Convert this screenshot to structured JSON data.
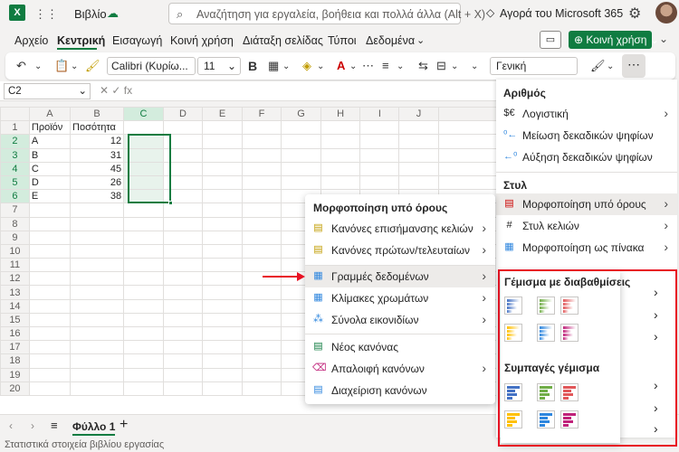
{
  "app": {
    "logo": "X",
    "book_title": "Βιβλίο",
    "search_placeholder": "Αναζήτηση για εργαλεία, βοήθεια και πολλά άλλα (Alt + X)",
    "buy_label": "Αγορά του Microsoft 365"
  },
  "tabs": [
    "Αρχείο",
    "Κεντρική",
    "Εισαγωγή",
    "Κοινή χρήση",
    "Διάταξη σελίδας",
    "Τύποι",
    "Δεδομένα"
  ],
  "share_label": "Κοινή χρήση",
  "toolbar": {
    "font": "Calibri (Κυρίω...",
    "size": "11",
    "bold": "B",
    "number_format": "Γενική"
  },
  "namebox": "C2",
  "formula_icons": "✕   ✓   fx",
  "columns": [
    "A",
    "B",
    "C",
    "D",
    "E",
    "F",
    "G",
    "H",
    "I",
    "J"
  ],
  "rows": [
    {
      "n": "1",
      "a": "Προϊόν",
      "b": "Ποσότητα"
    },
    {
      "n": "2",
      "a": "A",
      "b": "12"
    },
    {
      "n": "3",
      "a": "B",
      "b": "31"
    },
    {
      "n": "4",
      "a": "C",
      "b": "45"
    },
    {
      "n": "5",
      "a": "D",
      "b": "26"
    },
    {
      "n": "6",
      "a": "E",
      "b": "38"
    },
    {
      "n": "7",
      "a": "",
      "b": ""
    },
    {
      "n": "8",
      "a": "",
      "b": ""
    },
    {
      "n": "9",
      "a": "",
      "b": ""
    },
    {
      "n": "10",
      "a": "",
      "b": ""
    },
    {
      "n": "11",
      "a": "",
      "b": ""
    },
    {
      "n": "12",
      "a": "",
      "b": ""
    },
    {
      "n": "13",
      "a": "",
      "b": ""
    },
    {
      "n": "14",
      "a": "",
      "b": ""
    },
    {
      "n": "15",
      "a": "",
      "b": ""
    },
    {
      "n": "16",
      "a": "",
      "b": ""
    },
    {
      "n": "17",
      "a": "",
      "b": ""
    },
    {
      "n": "18",
      "a": "",
      "b": ""
    },
    {
      "n": "19",
      "a": "",
      "b": ""
    },
    {
      "n": "20",
      "a": "",
      "b": ""
    }
  ],
  "sheet_tab": "Φύλλο 1",
  "status": "Στατιστικά στοιχεία βιβλίου εργασίας",
  "cf_menu": {
    "title": "Μορφοποίηση υπό όρους",
    "items": [
      "Κανόνες επισήμανσης κελιών",
      "Κανόνες πρώτων/τελευταίων",
      "Γραμμές δεδομένων",
      "Κλίμακες χρωμάτων",
      "Σύνολα εικονιδίων",
      "Νέος κανόνας",
      "Απαλοιφή κανόνων",
      "Διαχείριση κανόνων"
    ]
  },
  "right_pane": {
    "section_number": "Αριθμός",
    "accounting": "Λογιστική",
    "decrease_decimals": "Μείωση δεκαδικών ψηφίων",
    "increase_decimals": "Αύξηση δεκαδικών ψηφίων",
    "section_style": "Στυλ",
    "conditional_formatting": "Μορφοποίηση υπό όρους",
    "cell_styles": "Στυλ κελιών",
    "format_as_table": "Μορφοποίηση ως πίνακα"
  },
  "databars": {
    "gradient_title": "Γέμισμα με διαβαθμίσεις",
    "solid_title": "Συμπαγές γέμισμα",
    "colors": [
      "#4472c4",
      "#70ad47",
      "#e15759",
      "#ffc000",
      "#2e86de",
      "#c0227a"
    ]
  },
  "colors": {
    "accent": "#107c41",
    "highlight_frame": "#e81123"
  }
}
